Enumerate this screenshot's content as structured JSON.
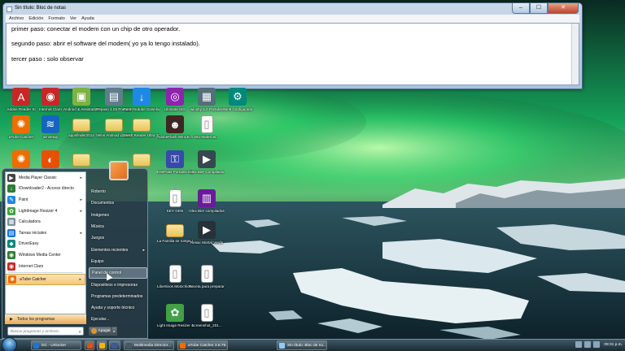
{
  "notepad": {
    "title": "Sin título: Bloc de notas",
    "menu": [
      "Archivo",
      "Edición",
      "Formato",
      "Ver",
      "Ayuda"
    ],
    "lines": [
      "primer paso: conectar el modem con un chip de otro operador.",
      "segundo paso: abrir el software del modem( yo ya lo tengo instalado).",
      "tercer paso : solo observar"
    ],
    "buttons": {
      "minimize": "–",
      "maximize": "☐",
      "close": "✕"
    }
  },
  "desktop": {
    "icons": [
      {
        "label": "Adobe Reader XI",
        "icon": "pdf-icon",
        "color": "#c62828",
        "glyph": "A"
      },
      {
        "label": "Internet Claro",
        "icon": "globe-icon",
        "color": "#c62828",
        "glyph": "◉"
      },
      {
        "label": "Android & Assistant Pro",
        "icon": "android-icon",
        "color": "#7cb342",
        "glyph": "▣"
      },
      {
        "label": "Repaso 1.03 Portable",
        "icon": "app-icon",
        "color": "#607d8b",
        "glyph": "▤"
      },
      {
        "label": "Fast Youtube Download",
        "icon": "download-icon",
        "color": "#1e88e5",
        "glyph": "↓"
      },
      {
        "label": "Ultimate ISO",
        "icon": "disc-icon",
        "color": "#8e24aa",
        "glyph": "◎"
      },
      {
        "label": "winsby 6.0 Portable",
        "icon": "app-icon",
        "color": "#546e7a",
        "glyph": "▦"
      },
      {
        "label": "Win9 Configuratio",
        "icon": "config-icon",
        "color": "#00897b",
        "glyph": "⚙"
      },
      {
        "label": "aTube Catcher",
        "icon": "atube-icon",
        "color": "#ef6c00",
        "glyph": "✺"
      },
      {
        "label": "winsetup",
        "icon": "wifi-icon",
        "color": "#1565c0",
        "glyph": "≋"
      },
      {
        "label": "appsfinder2014",
        "icon": "folder-icon",
        "color": "#f0c75e",
        "glyph": ""
      },
      {
        "label": "Velos Android v1.0.0.99",
        "icon": "folder-icon",
        "color": "#f0c75e",
        "glyph": ""
      },
      {
        "label": "Mesh Reader Ultra 2016.12",
        "icon": "folder-icon",
        "color": "#f0c75e",
        "glyph": ""
      },
      {
        "label": "AdobeFlash WinCE.ficom",
        "icon": "flash-icon",
        "color": "#3e2723",
        "glyph": "☻"
      },
      {
        "label": "Wiz-Baterías...",
        "icon": "doc-icon",
        "color": "#ffffff",
        "glyph": "▯"
      },
      {
        "label": "aTube Catcher",
        "icon": "atube-icon",
        "color": "#ef6c00",
        "glyph": "✺"
      },
      {
        "label": "Firefox",
        "icon": "firefox-icon",
        "color": "#e65100",
        "glyph": "◐"
      },
      {
        "label": "",
        "icon": "folder-icon",
        "color": "#f0c75e",
        "glyph": ""
      },
      {
        "label": "",
        "icon": "folder-icon",
        "color": "#f0c75e",
        "glyph": ""
      },
      {
        "label": "KeePass Portable Acceso directo",
        "icon": "keepass-icon",
        "color": "#3949ab",
        "glyph": "⚿"
      },
      {
        "label": "Olex Bier Compilador",
        "icon": "media-icon",
        "color": "#37474f",
        "glyph": "▶"
      },
      {
        "label": "KEY GEN",
        "icon": "doc-icon",
        "color": "#ffffff",
        "glyph": "▯"
      },
      {
        "label": "Olex Bier compilados",
        "icon": "rar-icon",
        "color": "#6a1b9a",
        "glyph": "▥"
      },
      {
        "label": "La Familia se rompe más...",
        "icon": "folder-icon",
        "color": "#f0c75e",
        "glyph": ""
      },
      {
        "label": "Resac Mortal Verde",
        "icon": "media-icon",
        "color": "#263238",
        "glyph": "▶"
      },
      {
        "label": "Libertinos Motochicks ...",
        "icon": "doc-icon",
        "color": "#ffffff",
        "glyph": "▯"
      },
      {
        "label": "Receta para preparar m...",
        "icon": "doc-icon",
        "color": "#ffffff",
        "glyph": "▯"
      },
      {
        "label": "Light Image Resizer 4",
        "icon": "image-icon",
        "color": "#43a047",
        "glyph": "✿"
      },
      {
        "label": "Screenshot_201...",
        "icon": "doc-icon",
        "color": "#ffffff",
        "glyph": "▯"
      }
    ]
  },
  "startmenu": {
    "programs": [
      {
        "label": "Media Player Classic",
        "color": "#444",
        "glyph": "▶",
        "arrow": "▸"
      },
      {
        "label": "IDownloader2 - Acceso directo",
        "color": "#2e7d32",
        "glyph": "↓",
        "arrow": ""
      },
      {
        "label": "Paint",
        "color": "#1e88e5",
        "glyph": "✎",
        "arrow": "▸"
      },
      {
        "label": "LightImage Resizer 4",
        "color": "#43a047",
        "glyph": "✿",
        "arrow": "▸"
      },
      {
        "label": "Calculadora",
        "color": "#78909c",
        "glyph": "▦",
        "arrow": ""
      },
      {
        "label": "Tareas iniciales",
        "color": "#1976d2",
        "glyph": "▤",
        "arrow": "▸"
      },
      {
        "label": "DriverEasy",
        "color": "#00897b",
        "glyph": "◆",
        "arrow": ""
      },
      {
        "label": "Windows Media Center",
        "color": "#2e7d32",
        "glyph": "◉",
        "arrow": ""
      },
      {
        "label": "Internet Claro",
        "color": "#c62828",
        "glyph": "◉",
        "arrow": ""
      },
      {
        "label": "aTube Catcher",
        "color": "#ef6c00",
        "glyph": "✺",
        "arrow": "▸"
      }
    ],
    "all_programs": "Todos los programas",
    "search_placeholder": "Buscar programas y archivos",
    "places": [
      "Roberto",
      "Documentos",
      "Imágenes",
      "Música",
      "Juegos",
      "Elementos recientes",
      "Equipo",
      "Panel de control",
      "Dispositivos e impresoras",
      "Programas predeterminados",
      "Ayuda y soporte técnico",
      "Ejecutar..."
    ],
    "shutdown": "Apagar"
  },
  "taskbar": {
    "tasks": [
      {
        "label": "DC - Unlocker",
        "color": "#1976d2"
      },
      {
        "label": "",
        "color": "#e65100"
      },
      {
        "label": "",
        "color": "#ffb300"
      },
      {
        "label": "[f] Modem de mi59...",
        "color": "#3b5998"
      },
      {
        "label": "Multimedia Director...",
        "color": "#455a64"
      },
      {
        "label": "aTube Catcher 3.8.79...",
        "color": "#ef6c00"
      },
      {
        "label": "Sin título: Bloc de no...",
        "color": "#90caf9"
      }
    ],
    "clock": "09:31 p.m."
  }
}
